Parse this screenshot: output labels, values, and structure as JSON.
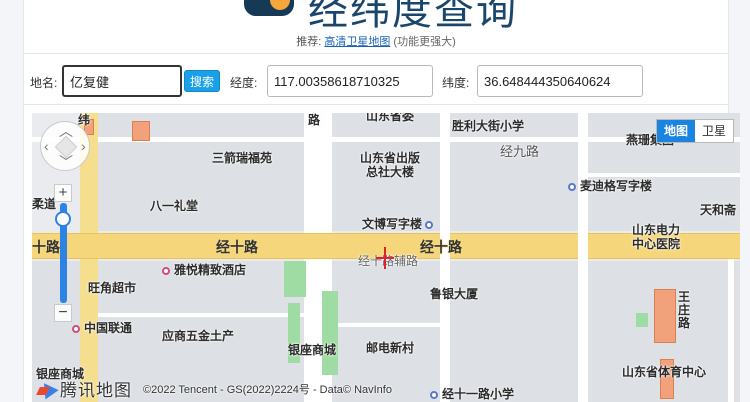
{
  "header": {
    "site_title": "经纬度查询"
  },
  "recommend": {
    "prefix": "推荐:",
    "link": "高清卫星地图",
    "note": "(功能更强大)"
  },
  "form": {
    "place_label": "地名:",
    "place_value": "亿复健",
    "search_button": "搜索",
    "lng_label": "经度:",
    "lng_value": "117.00358618710325",
    "lat_label": "纬度:",
    "lat_value": "36.648444350640624"
  },
  "map": {
    "type_switch": {
      "map": "地图",
      "satellite": "卫星",
      "active": "map"
    },
    "zoom_level_fraction": 0.9,
    "pois": {
      "wei_top": "纬",
      "shandong_top": "山东省委",
      "road_lu": "路",
      "shengli": "胜利大街小学",
      "jingjiu": "经九路",
      "yanshan": "燕珊集团",
      "sanjian": "三箭瑞福苑",
      "publish": "山东省出版\n总社大楼",
      "maidi": "麦迪格写字楼",
      "bayi": "八一礼堂",
      "roudao": "柔道",
      "tianhe": "天和斋",
      "wenbo": "文博写字楼",
      "electric": "山东电力\n中心医院",
      "jingshi_left": "经十路",
      "jingshi_right": "经十路",
      "shi_left": "十路",
      "aux_road": "经十路辅路",
      "yayue": "雅悦精致酒店",
      "wangjiao": "旺角超市",
      "luyin": "鲁银大厦",
      "wangzhuang": "王\n庄\n路",
      "unicom": "中国联通",
      "yingshang": "应商五金土产",
      "yinzuo": "银座商城",
      "post": "邮电新村",
      "yinzuo_left": "银座商城",
      "sports": "山东省体育中心",
      "school11": "经十一路小学"
    },
    "brand": "腾讯地图",
    "copyright": "©2022 Tencent - GS(2022)2224号 - Data© NavInfo"
  }
}
